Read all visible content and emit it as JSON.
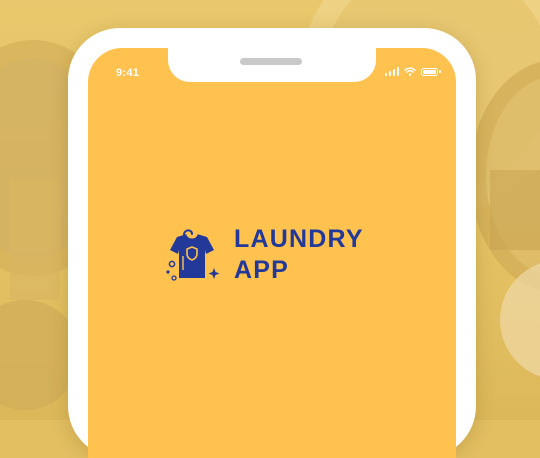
{
  "status_bar": {
    "time": "9:41",
    "icons": [
      "cellular-signal-icon",
      "wifi-icon",
      "battery-icon"
    ]
  },
  "logo": {
    "icon": "t-shirt-icon",
    "line1": "LAUNDRY",
    "line2": "APP"
  },
  "colors": {
    "screen_background": "#ffc24f",
    "brand_blue": "#23399a",
    "phone_frame": "#ffffff"
  }
}
